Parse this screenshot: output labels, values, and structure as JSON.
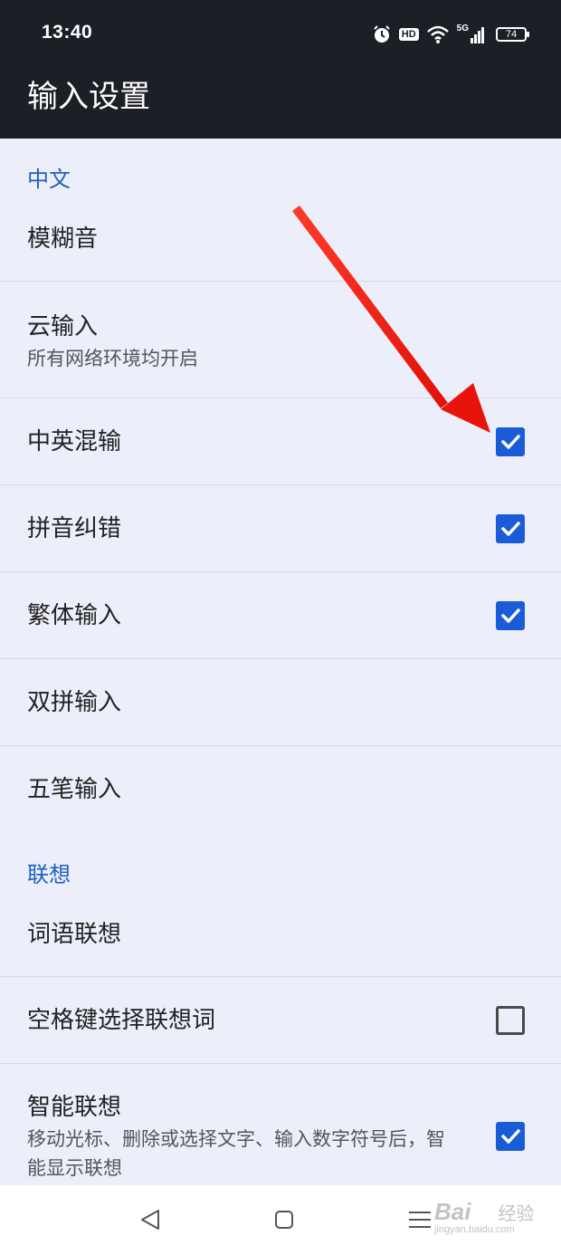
{
  "status_bar": {
    "time": "13:40",
    "hd_label": "HD",
    "network_label": "5G",
    "battery_level": "74"
  },
  "app_bar": {
    "title": "输入设置"
  },
  "sections": {
    "chinese": {
      "header": "中文",
      "fuzzy_pinyin": {
        "label": "模糊音"
      },
      "cloud_input": {
        "label": "云输入",
        "summary": "所有网络环境均开启"
      },
      "mixed_input": {
        "label": "中英混输",
        "checked": true
      },
      "pinyin_correction": {
        "label": "拼音纠错",
        "checked": true
      },
      "traditional_input": {
        "label": "繁体输入",
        "checked": true
      },
      "double_pinyin": {
        "label": "双拼输入"
      },
      "wubi_input": {
        "label": "五笔输入"
      }
    },
    "association": {
      "header": "联想",
      "word_association": {
        "label": "词语联想"
      },
      "space_select": {
        "label": "空格键选择联想词",
        "checked": false
      },
      "smart_association": {
        "label": "智能联想",
        "summary": "移动光标、删除或选择文字、输入数字符号后，智能显示联想",
        "checked": true
      }
    }
  },
  "watermark": {
    "brand": "Bai",
    "brand2": "经验",
    "url": "jingyan.baidu.com"
  },
  "colors": {
    "accent": "#1a5cd8",
    "header_text": "#1f5fc1",
    "annotation_arrow": "#e8140c"
  },
  "nav_icons": [
    "back-icon",
    "home-icon",
    "menu-icon"
  ]
}
